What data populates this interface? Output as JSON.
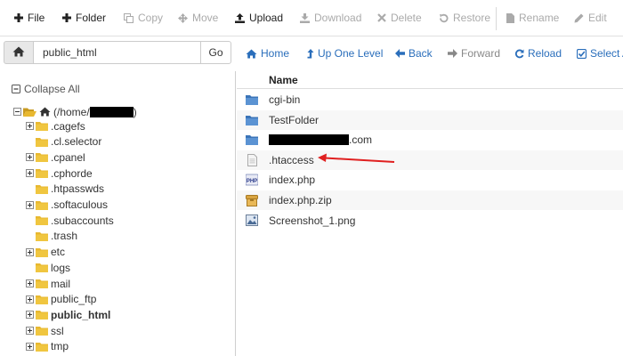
{
  "toolbar": {
    "file": "File",
    "folder": "Folder",
    "copy": "Copy",
    "move": "Move",
    "upload": "Upload",
    "download": "Download",
    "delete": "Delete",
    "restore": "Restore",
    "rename": "Rename",
    "edit": "Edit"
  },
  "pathbar": {
    "path_value": "public_html",
    "go_label": "Go"
  },
  "nav": {
    "home": "Home",
    "up_one_level": "Up One Level",
    "back": "Back",
    "forward": "Forward",
    "reload": "Reload",
    "select_all": "Select A"
  },
  "tree": {
    "collapse_all": "Collapse All",
    "root_prefix": "(/home/",
    "root_suffix": ")",
    "items": [
      {
        "label": ".cagefs"
      },
      {
        "label": ".cl.selector"
      },
      {
        "label": ".cpanel"
      },
      {
        "label": ".cphorde"
      },
      {
        "label": ".htpasswds"
      },
      {
        "label": ".softaculous"
      },
      {
        "label": ".subaccounts"
      },
      {
        "label": ".trash"
      },
      {
        "label": "etc"
      },
      {
        "label": "logs"
      },
      {
        "label": "mail"
      },
      {
        "label": "public_ftp"
      },
      {
        "label": "public_html"
      },
      {
        "label": "ssl"
      },
      {
        "label": "tmp"
      }
    ]
  },
  "list": {
    "header_name": "Name",
    "files": [
      {
        "name": "cgi-bin",
        "icon": "folder-icon"
      },
      {
        "name": "TestFolder",
        "icon": "folder-icon"
      },
      {
        "name": ".com",
        "icon": "folder-icon"
      },
      {
        "name": ".htaccess",
        "icon": "text-file-icon"
      },
      {
        "name": "index.php",
        "icon": "php-file-icon"
      },
      {
        "name": "index.php.zip",
        "icon": "archive-icon"
      },
      {
        "name": "Screenshot_1.png",
        "icon": "image-file-icon"
      }
    ]
  },
  "colors": {
    "link_blue": "#2a6ebb",
    "folder_yellow": "#e8b830",
    "folder_blue": "#4a86c8",
    "annotation_red": "#e02020"
  }
}
